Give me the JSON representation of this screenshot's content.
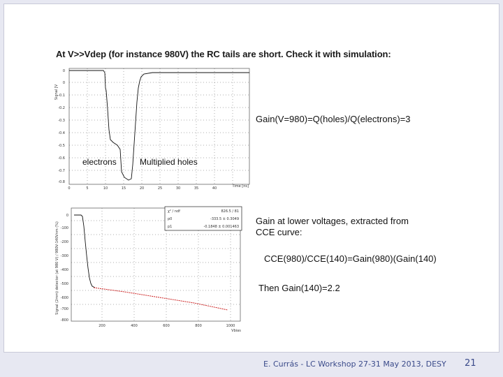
{
  "slide": {
    "heading": "At V>>Vdep (for instance 980V) the RC tails are short. Check it with simulation:",
    "gain_text": "Gain(V=980)=Q(holes)/Q(electrons)=3",
    "lower_line1": "Gain at lower voltages, extracted from",
    "lower_line2": "CCE curve:",
    "cce_eq": "CCE(980)/CCE(140)=Gain(980)(Gain(140)",
    "then_gain": "Then Gain(140)=2.2",
    "footer": "E. Currás -  LC Workshop 27-31 May 2013, DESY",
    "page_number": "21"
  },
  "top_plot": {
    "ylabel": "Signal [V",
    "xlabel": "Time [ns]",
    "yticks": [
      "0",
      "0",
      "-0.1",
      "-0.2",
      "-0.3",
      "-0.4",
      "-0.5",
      "-0.6",
      "-0.7",
      "-0.8"
    ],
    "xticks": [
      "0",
      "5",
      "10",
      "15",
      "20",
      "25",
      "30",
      "35",
      "40"
    ],
    "label_electrons": "electrons",
    "label_holes": "Multiplied holes"
  },
  "bottom_plot": {
    "ylabel": "Signal (2mm) detector (at 980 V) / 980V-140Vnm (%)",
    "xlabel": "Vbias",
    "yticks": [
      "0",
      "-100",
      "-200",
      "-300",
      "-400",
      "-500",
      "-600",
      "-700",
      "-800"
    ],
    "xticks": [
      "200",
      "400",
      "600",
      "800",
      "1000"
    ],
    "fit_box": {
      "row1_name": "χ² / ndf",
      "row1_val": "826.5 / 81",
      "row2_name": "p0",
      "row2_val": "-333.5 ± 0.3049",
      "row3_name": "p1",
      "row3_val": "-0.1848 ± 0.001463"
    }
  },
  "colors": {
    "background": "#e7e8f2",
    "footer": "#3a4a8a",
    "fit_line": "#cc2222"
  }
}
